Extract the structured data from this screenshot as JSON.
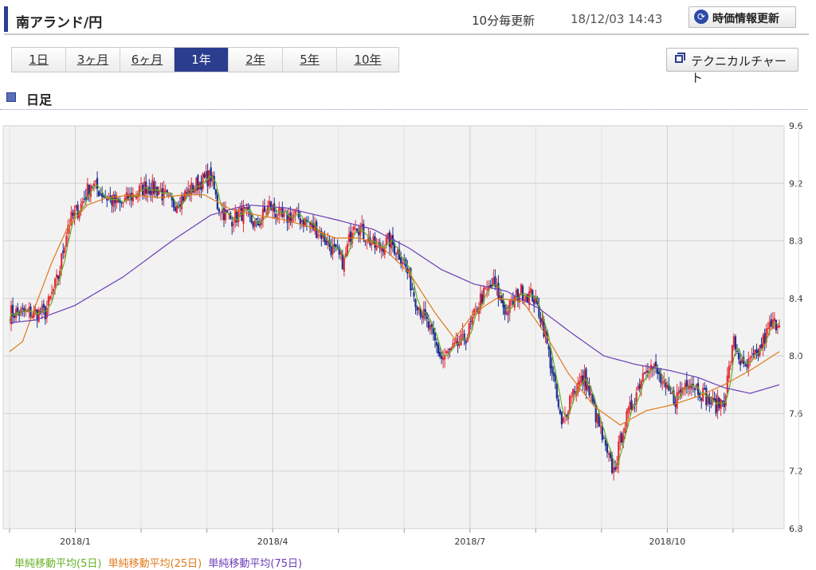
{
  "header": {
    "title": "南アランド/円",
    "update_note": "10分毎更新",
    "timestamp": "18/12/03 14:43",
    "refresh_label": "時価情報更新"
  },
  "tabs": [
    {
      "label": "1日",
      "active": false
    },
    {
      "label": "3ヶ月",
      "active": false
    },
    {
      "label": "6ヶ月",
      "active": false
    },
    {
      "label": "1年",
      "active": true
    },
    {
      "label": "2年",
      "active": false
    },
    {
      "label": "5年",
      "active": false
    },
    {
      "label": "10年",
      "active": false
    }
  ],
  "technical_chart_label": "テクニカルチャート",
  "section_title": "日足",
  "legend": [
    {
      "label": "単純移動平均(5日)",
      "color": "#66b022"
    },
    {
      "label": "単純移動平均(25日)",
      "color": "#e07a1a"
    },
    {
      "label": "単純移動平均(75日)",
      "color": "#6a3db5"
    }
  ],
  "chart_data": {
    "type": "candlestick",
    "title": "",
    "ylim": [
      6.8,
      9.6
    ],
    "y_ticks": [
      "9.6",
      "9.2",
      "8.8",
      "8.4",
      "8.0",
      "7.6",
      "7.2",
      "6.8"
    ],
    "x_ticks": [
      "2018/1",
      "2018/4",
      "2018/7",
      "2018/10"
    ],
    "grid": true,
    "colors": {
      "up": "#e0303a",
      "down": "#1f2f8c",
      "ma5": "#66b022",
      "ma25": "#e07a1a",
      "ma75": "#6a3db5"
    },
    "close_path": [
      [
        0,
        8.3
      ],
      [
        10,
        8.3
      ],
      [
        22,
        8.3
      ],
      [
        30,
        8.55
      ],
      [
        36,
        8.92
      ],
      [
        44,
        9.05
      ],
      [
        50,
        9.2
      ],
      [
        60,
        9.1
      ],
      [
        68,
        9.05
      ],
      [
        76,
        9.12
      ],
      [
        84,
        9.18
      ],
      [
        92,
        9.15
      ],
      [
        100,
        9.05
      ],
      [
        108,
        9.12
      ],
      [
        116,
        9.2
      ],
      [
        124,
        9.25
      ],
      [
        128,
        9.05
      ],
      [
        136,
        8.95
      ],
      [
        144,
        9.0
      ],
      [
        152,
        8.9
      ],
      [
        160,
        9.05
      ],
      [
        168,
        8.95
      ],
      [
        176,
        8.98
      ],
      [
        184,
        8.92
      ],
      [
        192,
        8.85
      ],
      [
        200,
        8.72
      ],
      [
        206,
        8.65
      ],
      [
        212,
        8.95
      ],
      [
        218,
        8.85
      ],
      [
        226,
        8.75
      ],
      [
        234,
        8.8
      ],
      [
        242,
        8.68
      ],
      [
        250,
        8.4
      ],
      [
        258,
        8.2
      ],
      [
        266,
        7.98
      ],
      [
        274,
        8.05
      ],
      [
        282,
        8.15
      ],
      [
        290,
        8.4
      ],
      [
        298,
        8.5
      ],
      [
        306,
        8.3
      ],
      [
        314,
        8.45
      ],
      [
        322,
        8.42
      ],
      [
        328,
        8.25
      ],
      [
        334,
        7.9
      ],
      [
        340,
        7.5
      ],
      [
        346,
        7.75
      ],
      [
        354,
        7.85
      ],
      [
        362,
        7.55
      ],
      [
        368,
        7.3
      ],
      [
        372,
        7.2
      ],
      [
        378,
        7.5
      ],
      [
        386,
        7.75
      ],
      [
        392,
        7.95
      ],
      [
        398,
        7.9
      ],
      [
        404,
        7.75
      ],
      [
        410,
        7.7
      ],
      [
        418,
        7.85
      ],
      [
        426,
        7.75
      ],
      [
        434,
        7.65
      ],
      [
        440,
        7.7
      ],
      [
        446,
        8.1
      ],
      [
        452,
        7.9
      ],
      [
        460,
        8.0
      ],
      [
        468,
        8.2
      ],
      [
        474,
        8.25
      ]
    ],
    "ma25_path": [
      [
        0,
        8.03
      ],
      [
        8,
        8.1
      ],
      [
        16,
        8.35
      ],
      [
        26,
        8.65
      ],
      [
        36,
        8.9
      ],
      [
        48,
        9.05
      ],
      [
        60,
        9.1
      ],
      [
        76,
        9.12
      ],
      [
        92,
        9.1
      ],
      [
        108,
        9.12
      ],
      [
        120,
        9.12
      ],
      [
        136,
        9.02
      ],
      [
        152,
        8.98
      ],
      [
        168,
        8.95
      ],
      [
        184,
        8.9
      ],
      [
        200,
        8.82
      ],
      [
        216,
        8.82
      ],
      [
        230,
        8.75
      ],
      [
        246,
        8.58
      ],
      [
        262,
        8.3
      ],
      [
        274,
        8.12
      ],
      [
        286,
        8.3
      ],
      [
        300,
        8.4
      ],
      [
        316,
        8.38
      ],
      [
        330,
        8.15
      ],
      [
        344,
        7.88
      ],
      [
        360,
        7.65
      ],
      [
        376,
        7.52
      ],
      [
        392,
        7.62
      ],
      [
        408,
        7.66
      ],
      [
        424,
        7.72
      ],
      [
        440,
        7.8
      ],
      [
        456,
        7.9
      ],
      [
        474,
        8.03
      ]
    ],
    "ma75_path": [
      [
        0,
        8.23
      ],
      [
        16,
        8.25
      ],
      [
        40,
        8.35
      ],
      [
        70,
        8.55
      ],
      [
        100,
        8.8
      ],
      [
        124,
        8.98
      ],
      [
        146,
        9.05
      ],
      [
        170,
        9.03
      ],
      [
        200,
        8.95
      ],
      [
        224,
        8.88
      ],
      [
        246,
        8.75
      ],
      [
        266,
        8.6
      ],
      [
        286,
        8.5
      ],
      [
        306,
        8.45
      ],
      [
        326,
        8.33
      ],
      [
        346,
        8.16
      ],
      [
        366,
        8.0
      ],
      [
        386,
        7.94
      ],
      [
        406,
        7.9
      ],
      [
        424,
        7.85
      ],
      [
        440,
        7.78
      ],
      [
        456,
        7.74
      ],
      [
        474,
        7.8
      ]
    ]
  }
}
